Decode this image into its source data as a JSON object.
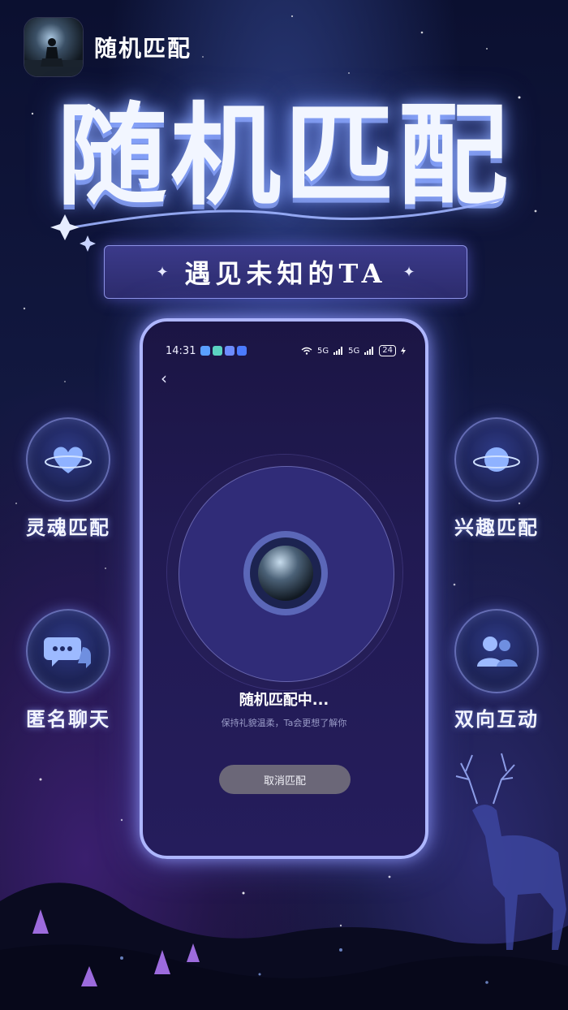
{
  "app": {
    "name": "随机匹配"
  },
  "hero": {
    "title": "随机匹配",
    "slogan": "遇见未知的TA",
    "sparkle": "✦"
  },
  "features": [
    {
      "label": "灵魂匹配",
      "icon": "heart-planet-icon"
    },
    {
      "label": "兴趣匹配",
      "icon": "planet-icon"
    },
    {
      "label": "匿名聊天",
      "icon": "chat-bubbles-icon"
    },
    {
      "label": "双向互动",
      "icon": "two-users-icon"
    }
  ],
  "phone": {
    "status": {
      "time": "14:31",
      "network": "5G",
      "battery": "24"
    },
    "back_icon": "‹",
    "matching_text": "随机匹配中...",
    "hint_text": "保持礼貌温柔，Ta会更想了解你",
    "cancel_label": "取消匹配"
  },
  "colors": {
    "accent": "#aeb6ff",
    "background": "#121840",
    "button": "#6b6778"
  }
}
